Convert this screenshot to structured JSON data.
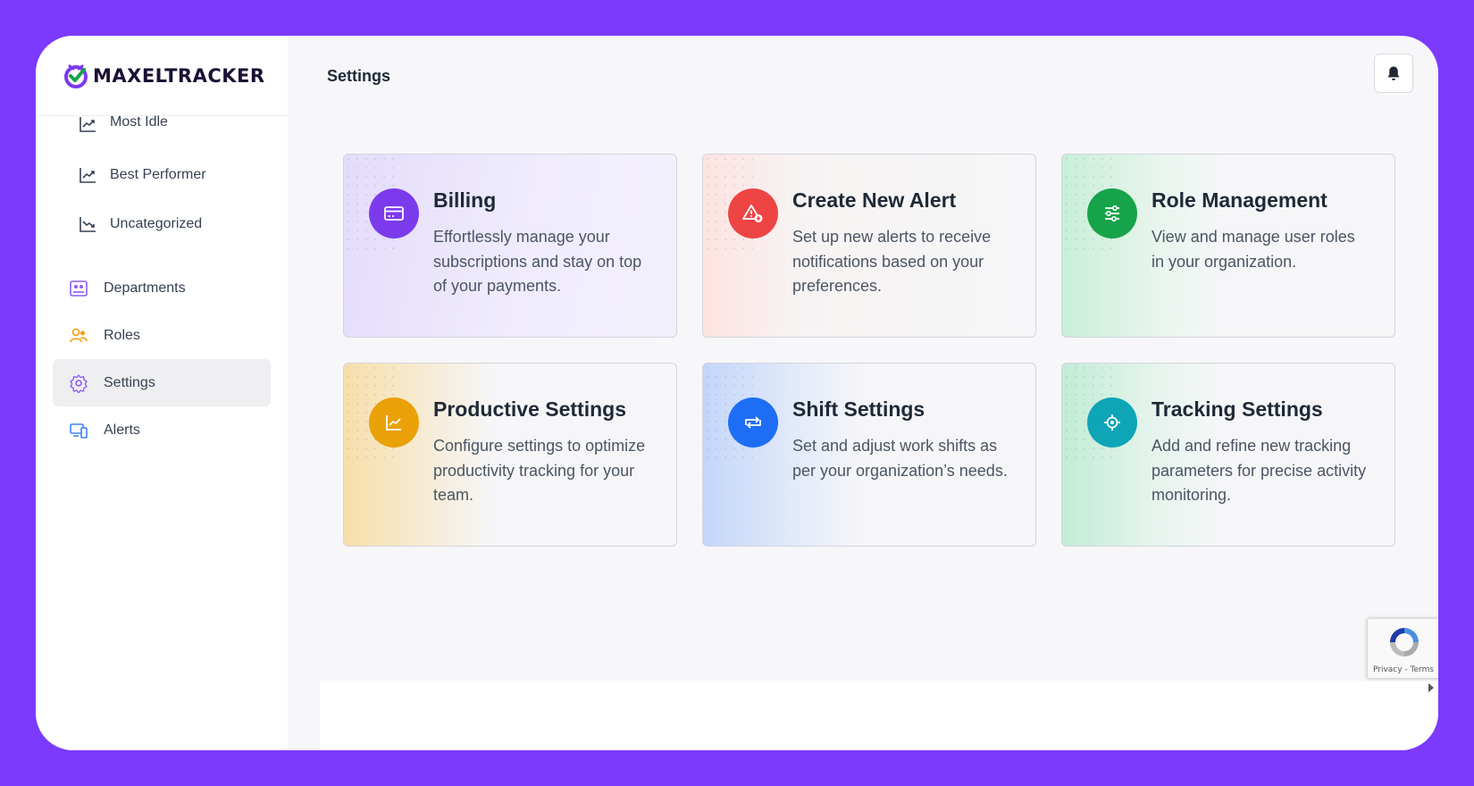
{
  "brand": {
    "name": "MAXELTRACKER",
    "colors": {
      "background": "#7c3aff",
      "logo_mark": "#7c3aed",
      "logo_check": "#16a34a"
    }
  },
  "sidebar": {
    "sub_items": [
      {
        "label": "Most Idle",
        "icon": "trend-up-icon"
      },
      {
        "label": "Best Performer",
        "icon": "trend-up-icon"
      },
      {
        "label": "Uncategorized",
        "icon": "trend-down-icon"
      }
    ],
    "items": [
      {
        "label": "Departments",
        "icon": "departments-icon",
        "color": "#8b5cf6",
        "active": false
      },
      {
        "label": "Roles",
        "icon": "roles-icon",
        "color": "#f59e0b",
        "active": false
      },
      {
        "label": "Settings",
        "icon": "gear-icon",
        "color": "#8b5cf6",
        "active": true
      },
      {
        "label": "Alerts",
        "icon": "devices-icon",
        "color": "#3b82f6",
        "active": false
      }
    ]
  },
  "header": {
    "title": "Settings",
    "notification_icon": "bell-icon"
  },
  "cards": [
    {
      "title": "Billing",
      "description": "Effortlessly manage your subscriptions and stay on top of your payments.",
      "icon": "credit-card-icon",
      "color": "#7c3aed"
    },
    {
      "title": "Create New Alert",
      "description": "Set up new alerts to receive notifications based on your preferences.",
      "icon": "alert-plus-icon",
      "color": "#ef4444"
    },
    {
      "title": "Role Management",
      "description": "View and manage user roles in your organization.",
      "icon": "sliders-icon",
      "color": "#16a34a"
    },
    {
      "title": "Productive Settings",
      "description": "Configure settings to optimize productivity tracking for your team.",
      "icon": "chart-line-icon",
      "color": "#eaa108"
    },
    {
      "title": "Shift Settings",
      "description": "Set and adjust work shifts as per your organization’s needs.",
      "icon": "swap-icon",
      "color": "#1d6ef5"
    },
    {
      "title": "Tracking Settings",
      "description": "Add and refine new tracking parameters for precise activity monitoring.",
      "icon": "target-icon",
      "color": "#0ea5b7"
    }
  ],
  "recaptcha": {
    "text": "Privacy - Terms"
  }
}
